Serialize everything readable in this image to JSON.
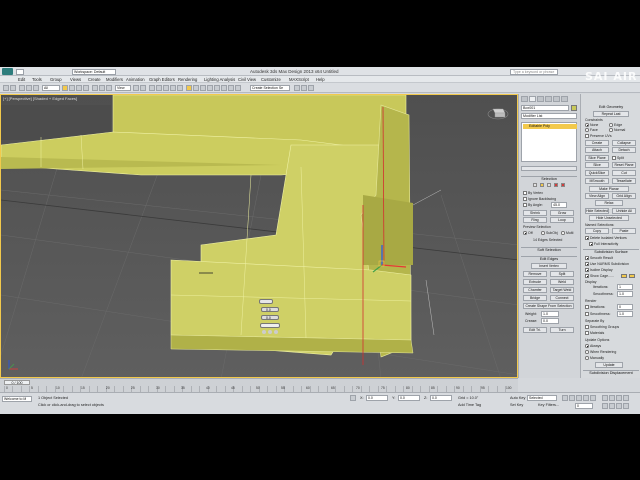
{
  "app": {
    "title": "Autodesk 3ds Max Design 2013 x64    Untitled",
    "search_placeholder": "Type a keyword or phrase",
    "workspace": "Workspace: Default"
  },
  "menus": [
    "Edit",
    "Tools",
    "Group",
    "Views",
    "Create",
    "Modifiers",
    "Animation",
    "Graph Editors",
    "Rendering",
    "Lighting Analysis",
    "Civil View",
    "Customize",
    "MAXScript",
    "Help"
  ],
  "toolbar": {
    "filter_label": "All",
    "viewport_label": "View",
    "selection_set": "Create Selection Se"
  },
  "viewport": {
    "label": "[+] [Perspective] [Shaded + Edged Faces]",
    "bevel_caddy": {
      "height": "0.0",
      "outline": "0.0"
    }
  },
  "command_panel": {
    "object_name": "Box001",
    "modifier_list": "Modifier List",
    "stack_item": "Editable Poly",
    "selection": {
      "title": "Selection",
      "by_vertex": "By Vertex",
      "ignore_backfacing": "Ignore Backfacing",
      "by_angle": "By Angle:",
      "angle": "45.0",
      "shrink": "Shrink",
      "grow": "Grow",
      "ring": "Ring",
      "loop": "Loop",
      "preview_selection": "Preview Selection",
      "off": "Off",
      "subobj": "SubObj",
      "multi": "Multi",
      "status": "14 Edges Selected"
    },
    "soft_selection": "Soft Selection",
    "edit_edges": {
      "title": "Edit Edges",
      "insert_vertex": "Insert Vertex",
      "remove": "Remove",
      "split": "Split",
      "extrude": "Extrude",
      "weld": "Weld",
      "chamfer": "Chamfer",
      "target_weld": "Target Weld",
      "bridge": "Bridge",
      "connect": "Connect",
      "create_shape": "Create Shape From Selection",
      "weight_label": "Weight:",
      "weight": "1.0",
      "crease_label": "Crease:",
      "crease": "0.0",
      "edit_tri": "Edit Tri.",
      "turn": "Turn"
    }
  },
  "command_panel_2": {
    "edit_geometry": "Edit Geometry",
    "repeat_last": "Repeat Last",
    "constraints": "Constraints",
    "none": "None",
    "edge": "Edge",
    "face": "Face",
    "normal": "Normal",
    "preserve_uvs": "Preserve UVs",
    "create": "Create",
    "collapse": "Collapse",
    "attach": "Attach",
    "detach": "Detach",
    "slice_plane": "Slice Plane",
    "split": "Split",
    "slice": "Slice",
    "reset_plane": "Reset Plane",
    "quickslice": "QuickSlice",
    "cut": "Cut",
    "msmooth": "MSmooth",
    "tessellate": "Tessellate",
    "make_planar": "Make Planar",
    "view_align": "View Align",
    "grid_align": "Grid Align",
    "relax": "Relax",
    "hide_selected": "Hide Selected",
    "unhide_all": "Unhide All",
    "hide_unselected": "Hide Unselected",
    "named_selections": "Named Selections:",
    "copy": "Copy",
    "paste": "Paste",
    "delete_isolated": "Delete Isolated Vertices",
    "full_interactivity": "Full Interactivity",
    "subdivision_surface": "Subdivision Surface",
    "smooth_result": "Smooth Result",
    "use_nurms": "Use NURMS Subdivision",
    "isoline_display": "Isoline Display",
    "show_cage": "Show Cage......",
    "display": "Display",
    "iterations_label": "Iterations:",
    "iterations": "1",
    "smoothness_label": "Smoothness:",
    "smoothness": "1.0",
    "render": "Render",
    "render_iterations": "0",
    "render_smoothness": "1.0",
    "separate_by": "Separate By",
    "smoothing_groups": "Smoothing Groups",
    "materials": "Materials",
    "update_options": "Update Options",
    "always": "Always",
    "when_rendering": "When Rendering",
    "manually": "Manually",
    "update": "Update",
    "subdivision_displacement": "Subdivision Displacement"
  },
  "timeline": {
    "slider": "0 / 100",
    "ticks": [
      "0",
      "5",
      "10",
      "15",
      "20",
      "25",
      "30",
      "35",
      "40",
      "45",
      "50",
      "55",
      "60",
      "65",
      "70",
      "75",
      "80",
      "85",
      "90",
      "95",
      "100"
    ]
  },
  "status": {
    "script_label": "Welcome to M",
    "objects_selected": "1 Object Selected",
    "prompt": "Click or click-and-drag to select objects",
    "x": "0.0",
    "y": "0.0",
    "z": "0.0",
    "grid": "Grid = 10.0\"",
    "auto_key": "Auto Key",
    "set_key": "Set Key",
    "selected": "Selected",
    "key_filters": "Key Filters...",
    "add_time_tag": "Add Time Tag",
    "frame": "0"
  },
  "watermark": "SAI AIR",
  "colors": {
    "selection_yellow": "#f2c94c",
    "mesh_fill": "#c8c85a",
    "viewport_bg": "#575757"
  }
}
